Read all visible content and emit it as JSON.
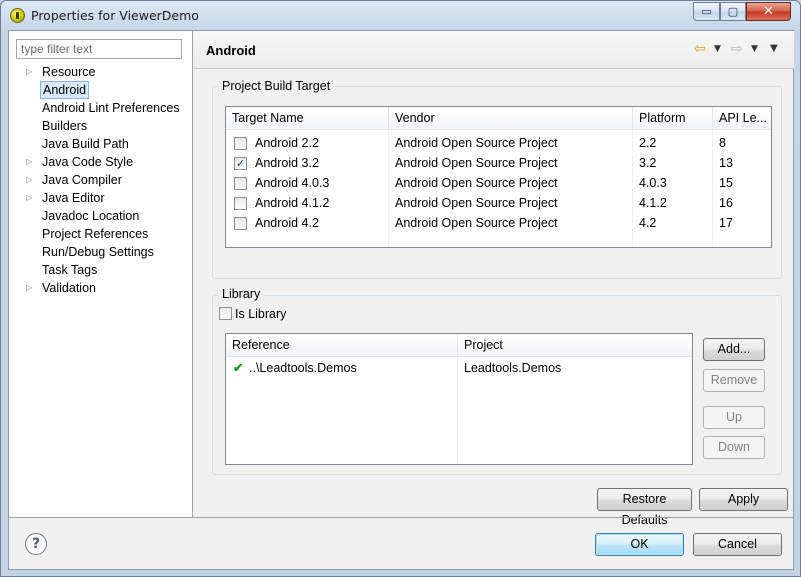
{
  "window": {
    "title": "Properties for ViewerDemo",
    "min_glyph": "▭",
    "max_glyph": "▢",
    "close_glyph": "✕"
  },
  "sidebar": {
    "filter_placeholder": "type filter text",
    "items": [
      {
        "label": "Resource",
        "expandable": true
      },
      {
        "label": "Android",
        "expandable": false,
        "selected": true
      },
      {
        "label": "Android Lint Preferences",
        "expandable": false
      },
      {
        "label": "Builders",
        "expandable": false
      },
      {
        "label": "Java Build Path",
        "expandable": false
      },
      {
        "label": "Java Code Style",
        "expandable": true
      },
      {
        "label": "Java Compiler",
        "expandable": true
      },
      {
        "label": "Java Editor",
        "expandable": true
      },
      {
        "label": "Javadoc Location",
        "expandable": false
      },
      {
        "label": "Project References",
        "expandable": false
      },
      {
        "label": "Run/Debug Settings",
        "expandable": false
      },
      {
        "label": "Task Tags",
        "expandable": false
      },
      {
        "label": "Validation",
        "expandable": true
      }
    ]
  },
  "page": {
    "title": "Android"
  },
  "build_target": {
    "group_label": "Project Build Target",
    "headers": [
      "Target Name",
      "Vendor",
      "Platform",
      "API Le..."
    ],
    "rows": [
      {
        "name": "Android 2.2",
        "vendor": "Android Open Source Project",
        "platform": "2.2",
        "api": "8",
        "checked": false
      },
      {
        "name": "Android 3.2",
        "vendor": "Android Open Source Project",
        "platform": "3.2",
        "api": "13",
        "checked": true
      },
      {
        "name": "Android 4.0.3",
        "vendor": "Android Open Source Project",
        "platform": "4.0.3",
        "api": "15",
        "checked": false
      },
      {
        "name": "Android 4.1.2",
        "vendor": "Android Open Source Project",
        "platform": "4.1.2",
        "api": "16",
        "checked": false
      },
      {
        "name": "Android 4.2",
        "vendor": "Android Open Source Project",
        "platform": "4.2",
        "api": "17",
        "checked": false
      }
    ]
  },
  "library": {
    "group_label": "Library",
    "is_library_label": "Is Library",
    "is_library_checked": false,
    "headers": [
      "Reference",
      "Project"
    ],
    "rows": [
      {
        "reference": "..\\Leadtools.Demos",
        "project": "Leadtools.Demos"
      }
    ],
    "buttons": {
      "add": "Add...",
      "remove": "Remove",
      "up": "Up",
      "down": "Down"
    }
  },
  "actions": {
    "restore_defaults": "Restore Defaults",
    "apply": "Apply"
  },
  "footer": {
    "help_glyph": "?",
    "ok": "OK",
    "cancel": "Cancel"
  },
  "colors": {
    "accent_selection": "#d9e9fa",
    "title_bar": "#c6d6e8",
    "close_button": "#c2381f",
    "check_green": "#1a9e1a"
  }
}
